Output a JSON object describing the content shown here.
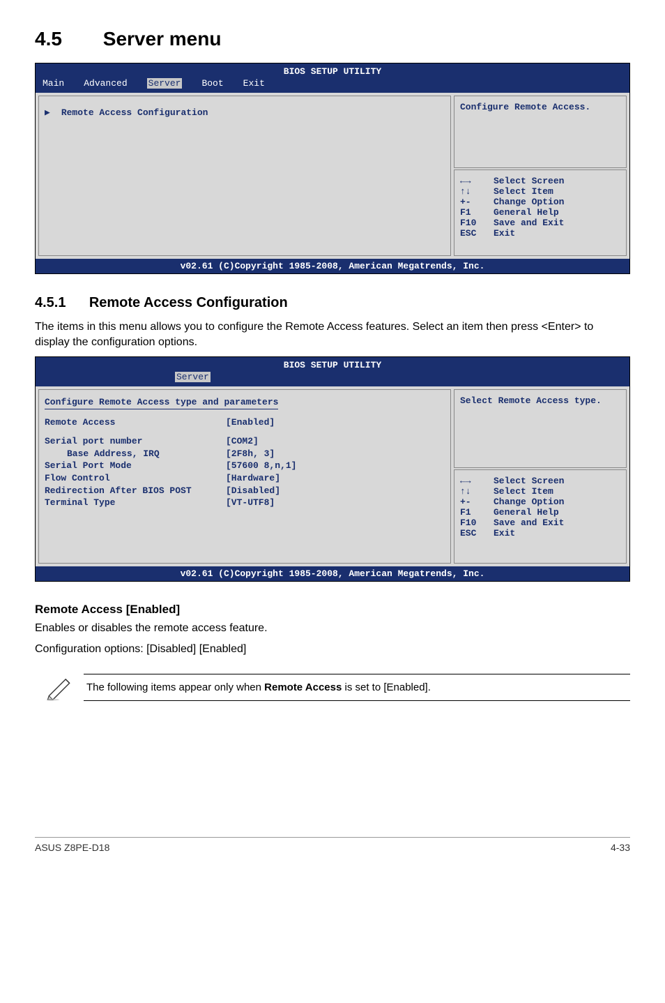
{
  "section": {
    "num": "4.5",
    "title": "Server menu"
  },
  "bios1": {
    "title": "BIOS SETUP UTILITY",
    "tabs": [
      "Main",
      "Advanced",
      "Server",
      "Boot",
      "Exit"
    ],
    "menu_item": "Remote Access Configuration",
    "help": "Configure Remote Access.",
    "keys": [
      {
        "k": "←→",
        "v": "Select Screen"
      },
      {
        "k": "↑↓",
        "v": "Select Item"
      },
      {
        "k": "+-",
        "v": "Change Option"
      },
      {
        "k": "F1",
        "v": "General Help"
      },
      {
        "k": "F10",
        "v": "Save and Exit"
      },
      {
        "k": "ESC",
        "v": "Exit"
      }
    ],
    "foot": "v02.61 (C)Copyright 1985-2008, American Megatrends, Inc."
  },
  "subsection": {
    "num": "4.5.1",
    "title": "Remote Access Configuration",
    "body": "The items in this menu allows you to configure the Remote Access features. Select an item then press <Enter> to display the configuration options."
  },
  "bios2": {
    "title": "BIOS SETUP UTILITY",
    "tab": "Server",
    "subtitle": "Configure Remote Access type and parameters",
    "items": [
      {
        "label": "Remote Access",
        "val": "[Enabled]",
        "indent": false,
        "spacer_after": true
      },
      {
        "label": "Serial port number",
        "val": "[COM2]",
        "indent": false
      },
      {
        "label": "Base Address, IRQ",
        "val": "[2F8h, 3]",
        "indent": true
      },
      {
        "label": "Serial Port Mode",
        "val": "[57600 8,n,1]",
        "indent": false
      },
      {
        "label": "Flow Control",
        "val": "[Hardware]",
        "indent": false
      },
      {
        "label": "Redirection After BIOS POST",
        "val": "[Disabled]",
        "indent": false
      },
      {
        "label": "Terminal Type",
        "val": "[VT-UTF8]",
        "indent": false
      }
    ],
    "help": "Select Remote Access type.",
    "keys": [
      {
        "k": "←→",
        "v": "Select Screen"
      },
      {
        "k": "↑↓",
        "v": "Select Item"
      },
      {
        "k": "+-",
        "v": "Change Option"
      },
      {
        "k": "F1",
        "v": "General Help"
      },
      {
        "k": "F10",
        "v": "Save and Exit"
      },
      {
        "k": "ESC",
        "v": "Exit"
      }
    ],
    "foot": "v02.61 (C)Copyright 1985-2008, American Megatrends, Inc."
  },
  "setting": {
    "title": "Remote Access [Enabled]",
    "desc1": "Enables or disables the remote access feature.",
    "desc2": "Configuration options: [Disabled] [Enabled]"
  },
  "note": "The following items appear only when Remote Access is set to [Enabled].",
  "note_bold": "Remote Access",
  "footer": {
    "left": "ASUS Z8PE-D18",
    "right": "4-33"
  }
}
